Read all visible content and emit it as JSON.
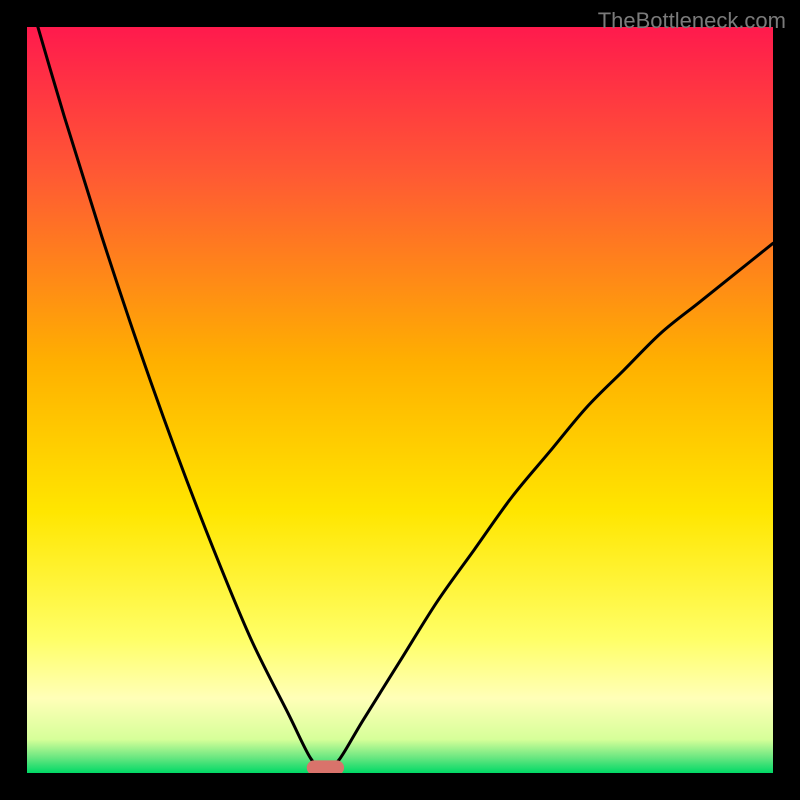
{
  "attribution": "TheBottleneck.com",
  "chart_data": {
    "type": "line",
    "title": "",
    "xlabel": "",
    "ylabel": "",
    "xlim": [
      0,
      100
    ],
    "ylim": [
      0,
      100
    ],
    "x_optimal": 40,
    "curve_left": {
      "x": [
        0,
        5,
        10,
        15,
        20,
        25,
        30,
        35,
        38,
        40
      ],
      "y": [
        105,
        88,
        72,
        57,
        43,
        30,
        18,
        8,
        2,
        0
      ]
    },
    "curve_right": {
      "x": [
        40,
        42,
        45,
        50,
        55,
        60,
        65,
        70,
        75,
        80,
        85,
        90,
        95,
        100
      ],
      "y": [
        0,
        2,
        7,
        15,
        23,
        30,
        37,
        43,
        49,
        54,
        59,
        63,
        67,
        71
      ]
    },
    "gradient_stops": [
      {
        "offset": 0.0,
        "color": "#ff1a4d"
      },
      {
        "offset": 0.2,
        "color": "#ff5a33"
      },
      {
        "offset": 0.45,
        "color": "#ffb000"
      },
      {
        "offset": 0.65,
        "color": "#ffe600"
      },
      {
        "offset": 0.82,
        "color": "#ffff66"
      },
      {
        "offset": 0.9,
        "color": "#ffffb8"
      },
      {
        "offset": 0.955,
        "color": "#d6ff99"
      },
      {
        "offset": 0.98,
        "color": "#66e680"
      },
      {
        "offset": 1.0,
        "color": "#00d966"
      }
    ],
    "marker": {
      "x": 40,
      "y": 0,
      "color": "#d9736b",
      "width": 5,
      "height": 2,
      "rx": 1
    }
  }
}
